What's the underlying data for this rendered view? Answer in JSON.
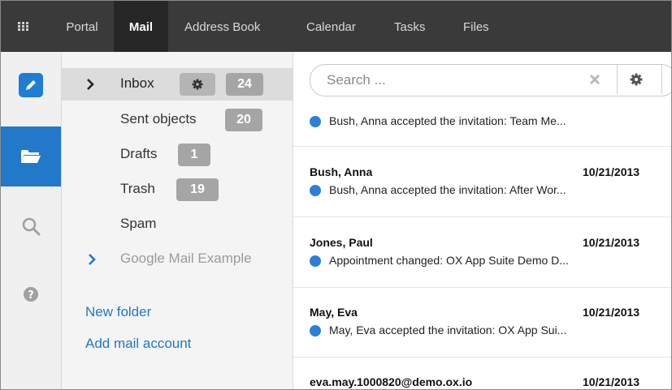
{
  "topbar": {
    "tabs": [
      {
        "label": "Portal"
      },
      {
        "label": "Mail",
        "active": true
      },
      {
        "label": "Address Book"
      },
      {
        "label": "Calendar"
      },
      {
        "label": "Tasks"
      },
      {
        "label": "Files"
      }
    ]
  },
  "rail": {
    "icons": [
      "pencil-icon",
      "folder-open-icon",
      "search-icon",
      "help-icon"
    ]
  },
  "folders": {
    "items": [
      {
        "label": "Inbox",
        "count": "24",
        "selected": true
      },
      {
        "label": "Sent objects",
        "count": "20"
      },
      {
        "label": "Drafts",
        "count": "1"
      },
      {
        "label": "Trash",
        "count": "19"
      },
      {
        "label": "Spam"
      },
      {
        "label": "Google Mail Example"
      }
    ],
    "new_folder": "New folder",
    "add_account": "Add mail account"
  },
  "search": {
    "placeholder": "Search ..."
  },
  "mails": [
    {
      "sender": "",
      "date": "",
      "subject": "Bush, Anna accepted the invitation: Team Me..."
    },
    {
      "sender": "Bush, Anna",
      "date": "10/21/2013",
      "subject": "Bush, Anna accepted the invitation: After Wor..."
    },
    {
      "sender": "Jones, Paul",
      "date": "10/21/2013",
      "subject": "Appointment changed: OX App Suite Demo D..."
    },
    {
      "sender": "May, Eva",
      "date": "10/21/2013",
      "subject": "May, Eva accepted the invitation: OX App Sui..."
    },
    {
      "sender": "eva.may.1000820@demo.ox.io",
      "date": "10/21/2013",
      "subject": ""
    }
  ],
  "colors": {
    "topbar": "#3a3a3a",
    "accent": "#2278c9",
    "unread": "#2b7fd6",
    "badge": "#a5a5a5"
  }
}
